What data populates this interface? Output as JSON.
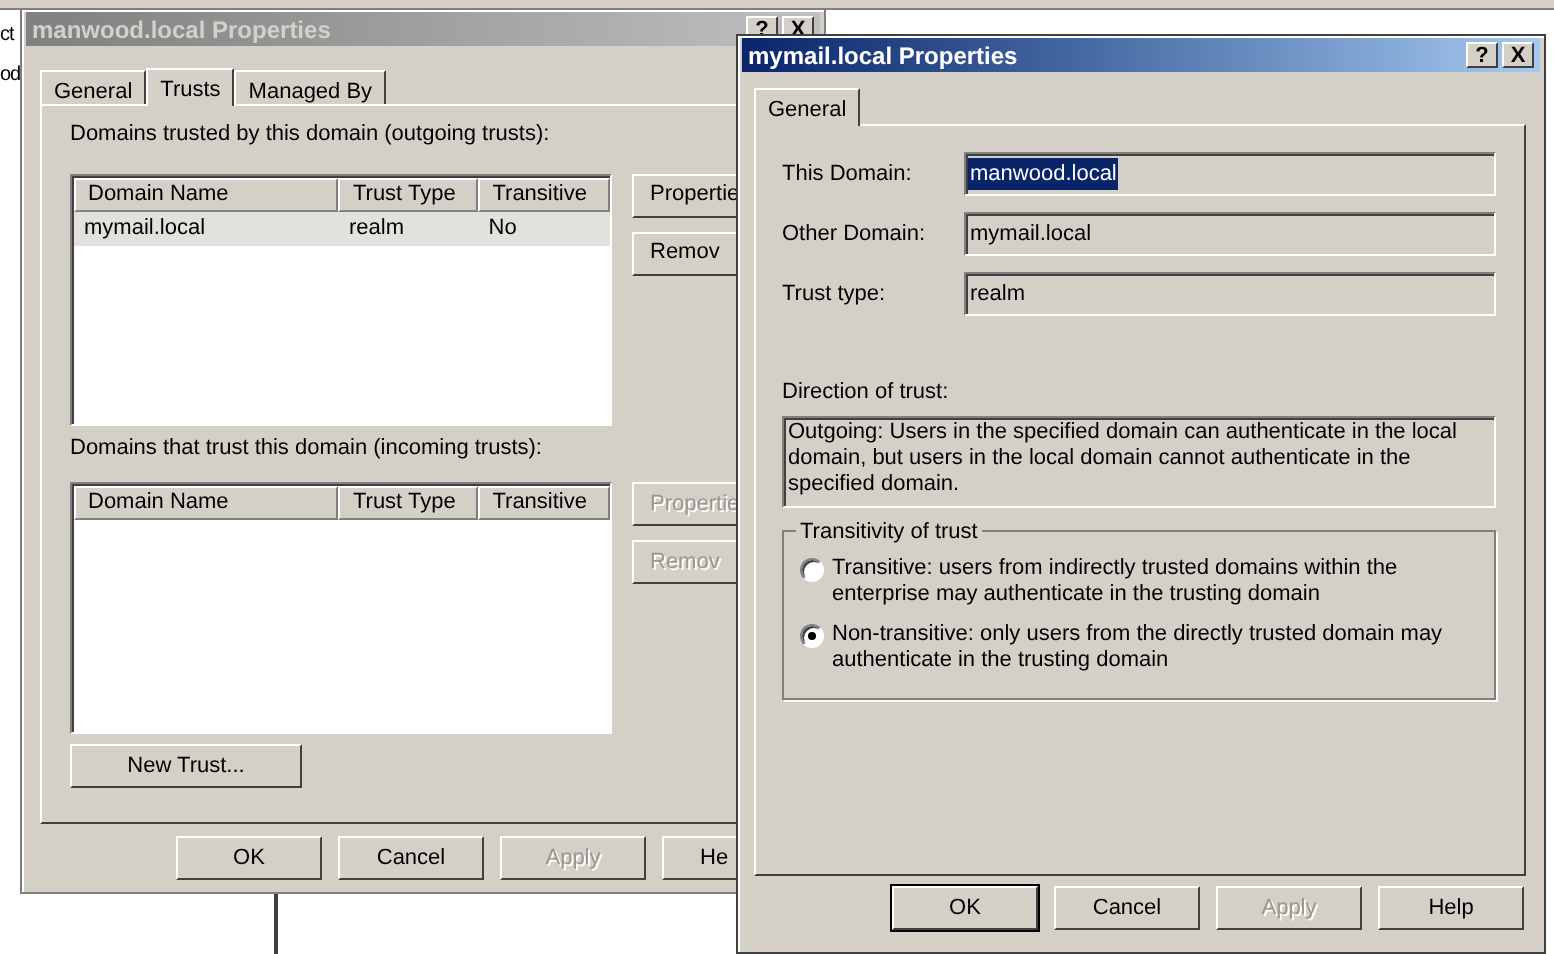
{
  "background_texts": [
    "ct",
    "od"
  ],
  "domain_window": {
    "title": "manwood.local Properties",
    "active": false,
    "title_buttons": [
      "?",
      "X"
    ],
    "tabs": [
      {
        "label": "General",
        "selected": false
      },
      {
        "label": "Trusts",
        "selected": true
      },
      {
        "label": "Managed By",
        "selected": false
      }
    ],
    "outgoing_label": "Domains trusted by this domain (outgoing trusts):",
    "outgoing_list": {
      "columns": [
        "Domain Name",
        "Trust Type",
        "Transitive"
      ],
      "rows": [
        {
          "cells": [
            "mymail.local",
            "realm",
            "No"
          ],
          "selected": true
        }
      ]
    },
    "outgoing_buttons": [
      {
        "label": "Propertie",
        "disabled": false
      },
      {
        "label": "Remov",
        "disabled": false
      }
    ],
    "incoming_label": "Domains that trust this domain (incoming trusts):",
    "incoming_list": {
      "columns": [
        "Domain Name",
        "Trust Type",
        "Transitive"
      ]
    },
    "incoming_buttons": [
      {
        "label": "Propertie",
        "disabled": true
      },
      {
        "label": "Remov",
        "disabled": true
      }
    ],
    "new_trust_button": "New Trust...",
    "buttons": [
      {
        "label": "OK",
        "disabled": false
      },
      {
        "label": "Cancel",
        "disabled": false
      },
      {
        "label": "Apply",
        "disabled": true
      },
      {
        "label": "He",
        "disabled": false
      }
    ]
  },
  "trust_window": {
    "title": "mymail.local Properties",
    "active": true,
    "title_buttons": [
      "?",
      "X"
    ],
    "tabs": [
      {
        "label": "General",
        "selected": true
      }
    ],
    "fields": [
      {
        "label": "This Domain:",
        "value": "manwood.local",
        "selected": true
      },
      {
        "label": "Other Domain:",
        "value": "mymail.local",
        "selected": false
      },
      {
        "label": "Trust type:",
        "value": "realm",
        "selected": false
      }
    ],
    "direction_label": "Direction of trust:",
    "direction_text": "Outgoing: Users in the specified domain can authenticate in the local domain, but users in the local domain cannot authenticate in the specified domain.",
    "transitivity": {
      "title": "Transitivity of trust",
      "options": [
        {
          "label": "Transitive: users from indirectly trusted domains within the enterprise may authenticate in the trusting domain",
          "selected": false
        },
        {
          "label": "Non-transitive: only users from the directly trusted domain may authenticate in the trusting domain",
          "selected": true
        }
      ]
    },
    "buttons": [
      {
        "label": "OK",
        "disabled": false,
        "default": true
      },
      {
        "label": "Cancel",
        "disabled": false,
        "default": false
      },
      {
        "label": "Apply",
        "disabled": true,
        "default": false
      },
      {
        "label": "Help",
        "disabled": false,
        "default": false
      }
    ]
  }
}
